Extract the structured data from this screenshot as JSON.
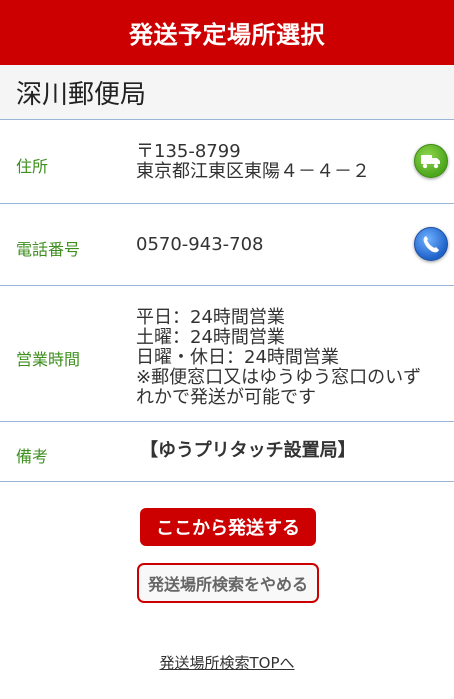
{
  "header": {
    "title": "発送予定場所選択"
  },
  "office": {
    "name": "深川郵便局"
  },
  "address": {
    "label": "住所",
    "postal": "〒135-8799",
    "street": "東京都江東区東陽４－４－２",
    "icon": "map-icon",
    "icon_color": "#4da61c"
  },
  "phone": {
    "label": "電話番号",
    "number": "0570-943-708",
    "icon": "phone-icon",
    "icon_color": "#1f62c9"
  },
  "hours": {
    "label": "営業時間",
    "lines": [
      "平日：24時間営業",
      "土曜：24時間営業",
      "日曜・休日：24時間営業",
      "※郵便窓口又はゆうゆう窓口のいず",
      "れかで発送が可能です"
    ]
  },
  "notes": {
    "label": "備考",
    "value": "【ゆうプリタッチ設置局】"
  },
  "actions": {
    "ship_here": "ここから発送する",
    "cancel_search": "発送場所検索をやめる"
  },
  "footer": {
    "top_link": "発送場所検索TOPへ"
  },
  "colors": {
    "brand_red": "#cc0000",
    "label_green": "#3e8f1f",
    "divider_blue": "#9ab6d6"
  }
}
